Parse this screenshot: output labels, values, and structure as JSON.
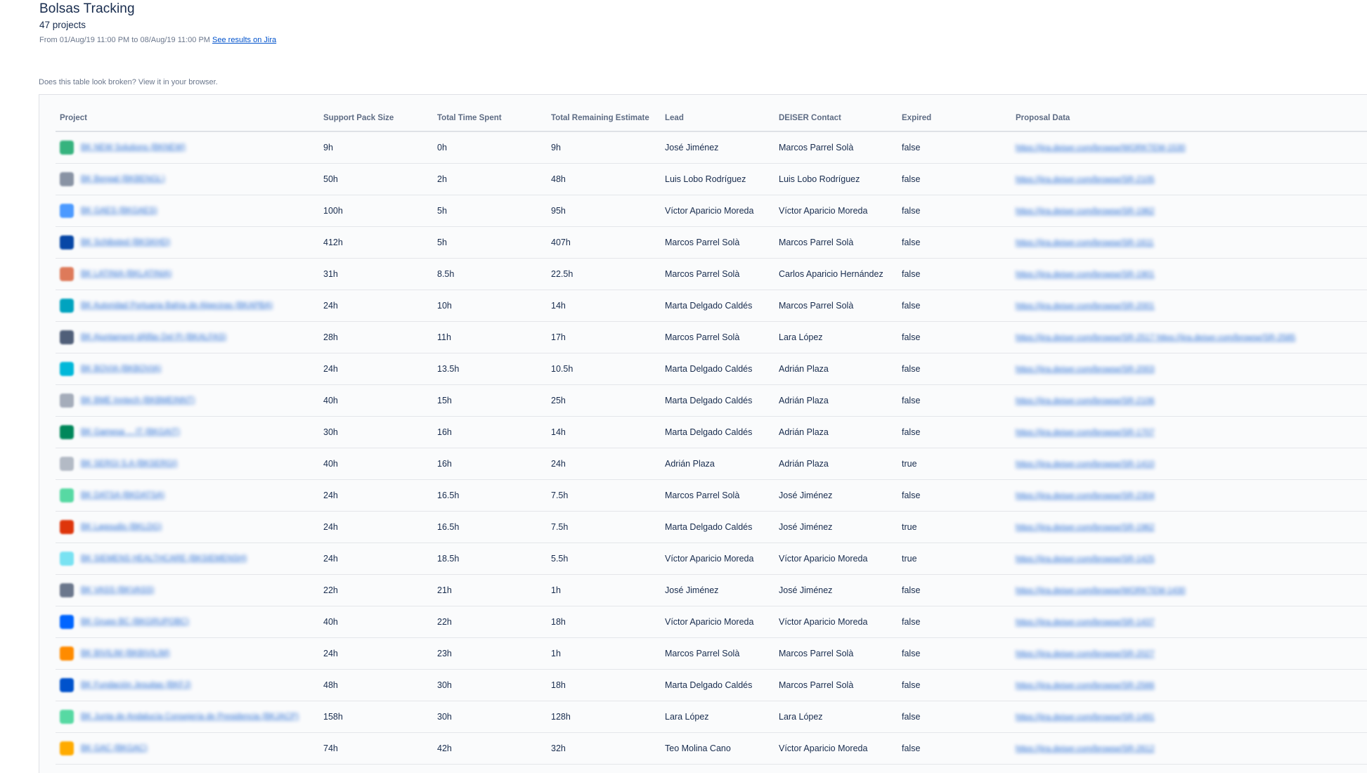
{
  "header": {
    "title": "Bolsas Tracking",
    "count": "47 projects",
    "range_text": "From 01/Aug/19 11:00 PM to 08/Aug/19 11:00 PM",
    "jira_link": "See results on Jira",
    "broken_note": "Does this table look broken? View it in your browser."
  },
  "table": {
    "columns": [
      "Project",
      "Support Pack Size",
      "Total Time Spent",
      "Total Remaining Estimate",
      "Lead",
      "DEISER Contact",
      "Expired",
      "Proposal Data"
    ],
    "rows": [
      {
        "project": "BK NEW Solutions (BKNEW)",
        "icon_color": "#36b37e",
        "size": "9h",
        "spent": "0h",
        "remaining": "9h",
        "lead": "José Jiménez",
        "contact": "Marcos Parrel Solà",
        "expired": "false",
        "proposal": "https://jira.deiser.com/browse/WORKTEM-1530"
      },
      {
        "project": "BK Bengal (BKBENGL)",
        "icon_color": "#8993a4",
        "size": "50h",
        "spent": "2h",
        "remaining": "48h",
        "lead": "Luis Lobo Rodríguez",
        "contact": "Luis Lobo Rodríguez",
        "expired": "false",
        "proposal": "https://jira.deiser.com/browse/SR-2105"
      },
      {
        "project": "BK GAES (BKGAES)",
        "icon_color": "#4c9aff",
        "size": "100h",
        "spent": "5h",
        "remaining": "95h",
        "lead": "Víctor Aparicio Moreda",
        "contact": "Víctor Aparicio Moreda",
        "expired": "false",
        "proposal": "https://jira.deiser.com/browse/SR-1962"
      },
      {
        "project": "BK Schibsted (BKSKHD)",
        "icon_color": "#0747a6",
        "size": "412h",
        "spent": "5h",
        "remaining": "407h",
        "lead": "Marcos Parrel Solà",
        "contact": "Marcos Parrel Solà",
        "expired": "false",
        "proposal": "https://jira.deiser.com/browse/SR-1611"
      },
      {
        "project": "BK LATINIA (BKLATINIA)",
        "icon_color": "#de7a5a",
        "size": "31h",
        "spent": "8.5h",
        "remaining": "22.5h",
        "lead": "Marcos Parrel Solà",
        "contact": "Carlos Aparicio Hernández",
        "expired": "false",
        "proposal": "https://jira.deiser.com/browse/SR-1901"
      },
      {
        "project": "BK Autoridad Portuaria Bahía de Algeciras (BKAPBA)",
        "icon_color": "#00a3bf",
        "size": "24h",
        "spent": "10h",
        "remaining": "14h",
        "lead": "Marta Delgado Caldés",
        "contact": "Marcos Parrel Solà",
        "expired": "false",
        "proposal": "https://jira.deiser.com/browse/SR-2001"
      },
      {
        "project": "BK Ajuntament dÀlfàs Del Pi (BKALFAS)",
        "icon_color": "#505f79",
        "size": "28h",
        "spent": "11h",
        "remaining": "17h",
        "lead": "Marcos Parrel Solà",
        "contact": "Lara López",
        "expired": "false",
        "proposal": "https://jira.deiser.com/browse/SR-2517 https://jira.deiser.com/browse/SR-2585"
      },
      {
        "project": "BK BOVIA (BKBOVIA)",
        "icon_color": "#00b8d9",
        "size": "24h",
        "spent": "13.5h",
        "remaining": "10.5h",
        "lead": "Marta Delgado Caldés",
        "contact": "Adrián Plaza",
        "expired": "false",
        "proposal": "https://jira.deiser.com/browse/SR-2003"
      },
      {
        "project": "BK BME Inntech (BKBMEINNT)",
        "icon_color": "#a5adba",
        "size": "40h",
        "spent": "15h",
        "remaining": "25h",
        "lead": "Marta Delgado Caldés",
        "contact": "Adrián Plaza",
        "expired": "false",
        "proposal": "https://jira.deiser.com/browse/SR-2106"
      },
      {
        "project": "BK Gamesa ... IT (BKGAIT)",
        "icon_color": "#00875a",
        "size": "30h",
        "spent": "16h",
        "remaining": "14h",
        "lead": "Marta Delgado Caldés",
        "contact": "Adrián Plaza",
        "expired": "false",
        "proposal": "https://jira.deiser.com/browse/SR-1707"
      },
      {
        "project": "BK SERGI S.A (BKSERGI)",
        "icon_color": "#b3bac5",
        "size": "40h",
        "spent": "16h",
        "remaining": "24h",
        "lead": "Adrián Plaza",
        "contact": "Adrián Plaza",
        "expired": "true",
        "proposal": "https://jira.deiser.com/browse/SR-1410"
      },
      {
        "project": "BK DATSA (BKDATSA)",
        "icon_color": "#57d9a3",
        "size": "24h",
        "spent": "16.5h",
        "remaining": "7.5h",
        "lead": "Marcos Parrel Solà",
        "contact": "José Jiménez",
        "expired": "false",
        "proposal": "https://jira.deiser.com/browse/SR-2304"
      },
      {
        "project": "BK Lagoudis (BKLDG)",
        "icon_color": "#de350b",
        "size": "24h",
        "spent": "16.5h",
        "remaining": "7.5h",
        "lead": "Marta Delgado Caldés",
        "contact": "José Jiménez",
        "expired": "true",
        "proposal": "https://jira.deiser.com/browse/SR-1962"
      },
      {
        "project": "BK SIEMENS HEALTHCARE (BKSIEMENSH)",
        "icon_color": "#79e2f2",
        "size": "24h",
        "spent": "18.5h",
        "remaining": "5.5h",
        "lead": "Víctor Aparicio Moreda",
        "contact": "Víctor Aparicio Moreda",
        "expired": "true",
        "proposal": "https://jira.deiser.com/browse/SR-1425"
      },
      {
        "project": "BK VASS (BKVASS)",
        "icon_color": "#6b778c",
        "size": "22h",
        "spent": "21h",
        "remaining": "1h",
        "lead": "José Jiménez",
        "contact": "José Jiménez",
        "expired": "false",
        "proposal": "https://jira.deiser.com/browse/WORKTEM-1430"
      },
      {
        "project": "BK Grupo BC (BKGRUPOBC)",
        "icon_color": "#0065ff",
        "size": "40h",
        "spent": "22h",
        "remaining": "18h",
        "lead": "Víctor Aparicio Moreda",
        "contact": "Víctor Aparicio Moreda",
        "expired": "false",
        "proposal": "https://jira.deiser.com/browse/SR-1437"
      },
      {
        "project": "BK BIVILIM (BKBIVILIM)",
        "icon_color": "#ff8b00",
        "size": "24h",
        "spent": "23h",
        "remaining": "1h",
        "lead": "Marcos Parrel Solà",
        "contact": "Marcos Parrel Solà",
        "expired": "false",
        "proposal": "https://jira.deiser.com/browse/SR-2027"
      },
      {
        "project": "BK Fundación Jesuitas (BKFJ)",
        "icon_color": "#0052cc",
        "size": "48h",
        "spent": "30h",
        "remaining": "18h",
        "lead": "Marta Delgado Caldés",
        "contact": "Marcos Parrel Solà",
        "expired": "false",
        "proposal": "https://jira.deiser.com/browse/SR-2566"
      },
      {
        "project": "BK Junta de Andalucía Consejería de Presidencia (BKJACP)",
        "icon_color": "#57d9a3",
        "size": "158h",
        "spent": "30h",
        "remaining": "128h",
        "lead": "Lara López",
        "contact": "Lara López",
        "expired": "false",
        "proposal": "https://jira.deiser.com/browse/SR-1491"
      },
      {
        "project": "BK GAC (BKGAC)",
        "icon_color": "#ffab00",
        "size": "74h",
        "spent": "42h",
        "remaining": "32h",
        "lead": "Teo Molina Cano",
        "contact": "Víctor Aparicio Moreda",
        "expired": "false",
        "proposal": "https://jira.deiser.com/browse/SR-2612"
      }
    ]
  }
}
